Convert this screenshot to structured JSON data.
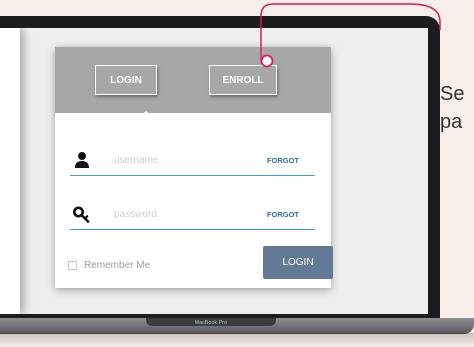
{
  "header": {
    "login_tab": "LOGIN",
    "enroll_tab": "ENROLL"
  },
  "fields": {
    "username_placeholder": "username",
    "password_placeholder": "password",
    "forgot_label_1": "FORGOT",
    "forgot_label_2": "FORGOT"
  },
  "footer": {
    "remember_label": "Remember Me",
    "login_button": "LOGIN"
  },
  "device": {
    "base_label": "MacBook Pro"
  },
  "side_text": {
    "line1": "Se",
    "line2": "pa"
  },
  "icons": {
    "user": "user-icon",
    "key": "key-icon"
  },
  "colors": {
    "header_gray": "#a7a7a7",
    "accent_blue": "#39a0d8",
    "link_blue": "#2b6fb3",
    "button_slate": "#637a96",
    "callout_pink": "#e01a5a"
  }
}
